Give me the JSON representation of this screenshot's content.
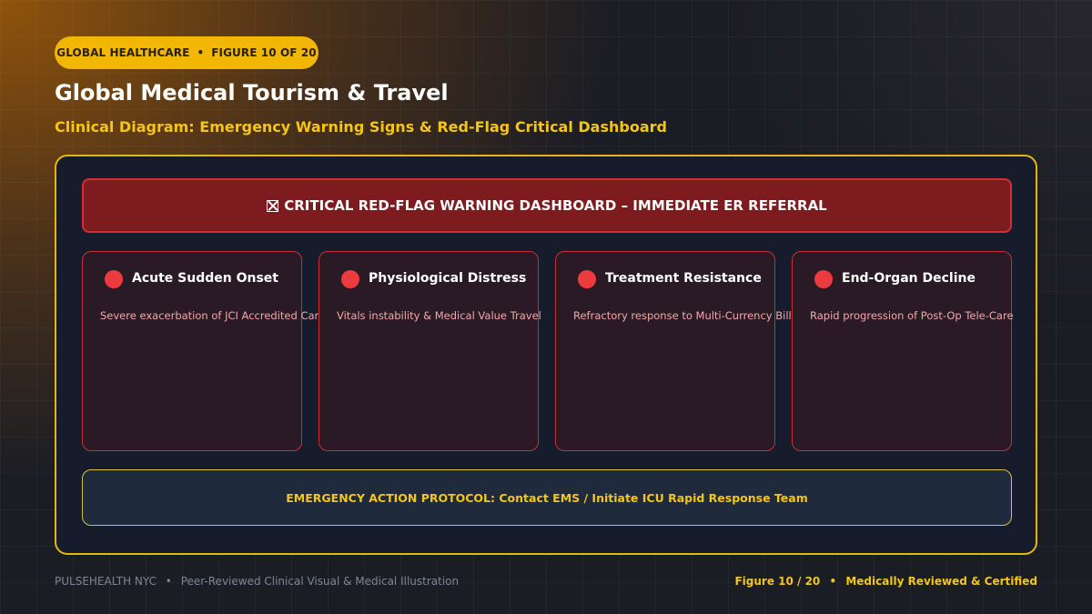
{
  "header": {
    "badge": {
      "category": "GLOBAL HEALTHCARE",
      "separator": "•",
      "figure": "FIGURE 10 OF 20"
    },
    "title": "Global Medical Tourism & Travel",
    "subtitle": "Clinical Diagram: Emergency Warning Signs & Red-Flag Critical Dashboard"
  },
  "diagram": {
    "banner": {
      "icon": "x-box-icon",
      "text": "CRITICAL RED-FLAG WARNING DASHBOARD – IMMEDIATE ER REFERRAL"
    },
    "cards": [
      {
        "title": "Acute Sudden Onset",
        "description": "Severe exacerbation of JCI Accredited Care"
      },
      {
        "title": "Physiological Distress",
        "description": "Vitals instability & Medical Value Travel"
      },
      {
        "title": "Treatment Resistance",
        "description": "Refractory response to Multi-Currency Billing"
      },
      {
        "title": "End-Organ Decline",
        "description": "Rapid progression of Post-Op Tele-Care"
      }
    ],
    "protocol": "EMERGENCY ACTION PROTOCOL: Contact EMS / Initiate ICU Rapid Response Team"
  },
  "footer": {
    "left": {
      "brand": "PULSEHEALTH NYC",
      "separator": "•",
      "tagline": "Peer-Reviewed Clinical Visual & Medical Illustration"
    },
    "right": {
      "figure": "Figure 10 / 20",
      "separator": "•",
      "certification": "Medically Reviewed & Certified"
    }
  },
  "colors": {
    "accent": "#f2b705",
    "alert_red": "#ec3b3f",
    "banner_red": "#7d1b1e",
    "panel": "#171c2c"
  }
}
